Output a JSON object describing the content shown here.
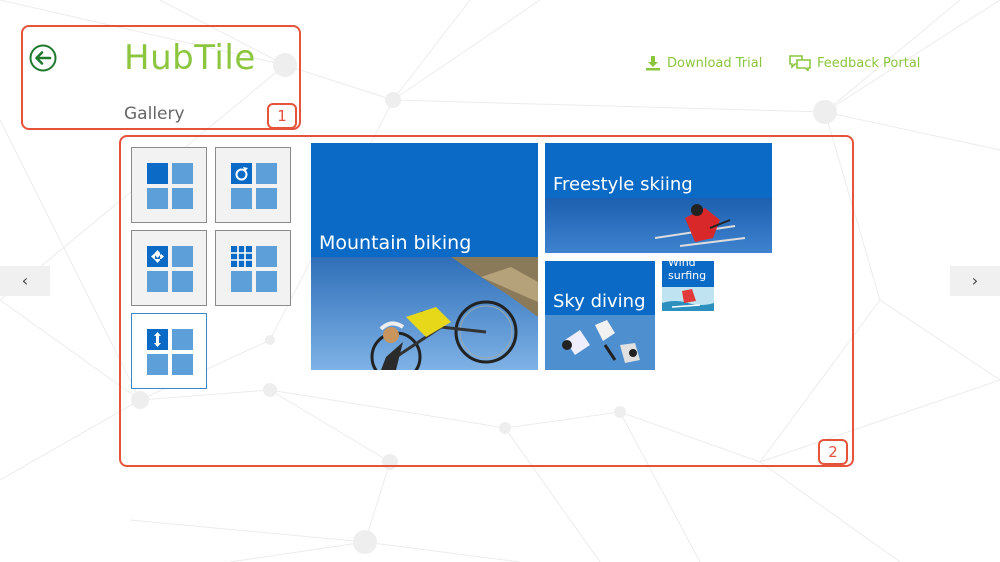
{
  "header": {
    "title": "HubTile",
    "subtitle": "Gallery",
    "back_icon": "back-arrow-icon"
  },
  "callouts": [
    "1",
    "2"
  ],
  "links": {
    "download": {
      "label": "Download Trial",
      "icon": "download-icon"
    },
    "feedback": {
      "label": "Feedback Portal",
      "icon": "feedback-icon"
    }
  },
  "nav": {
    "prev": "‹",
    "next": "›"
  },
  "tiles": {
    "mountain": "Mountain biking",
    "freestyle": "Freestyle skiing",
    "sky": "Sky diving",
    "wind": "Wind surfing"
  },
  "colors": {
    "accent": "#8cc63f",
    "tile": "#0a6ac6",
    "callout": "#e5533b"
  }
}
